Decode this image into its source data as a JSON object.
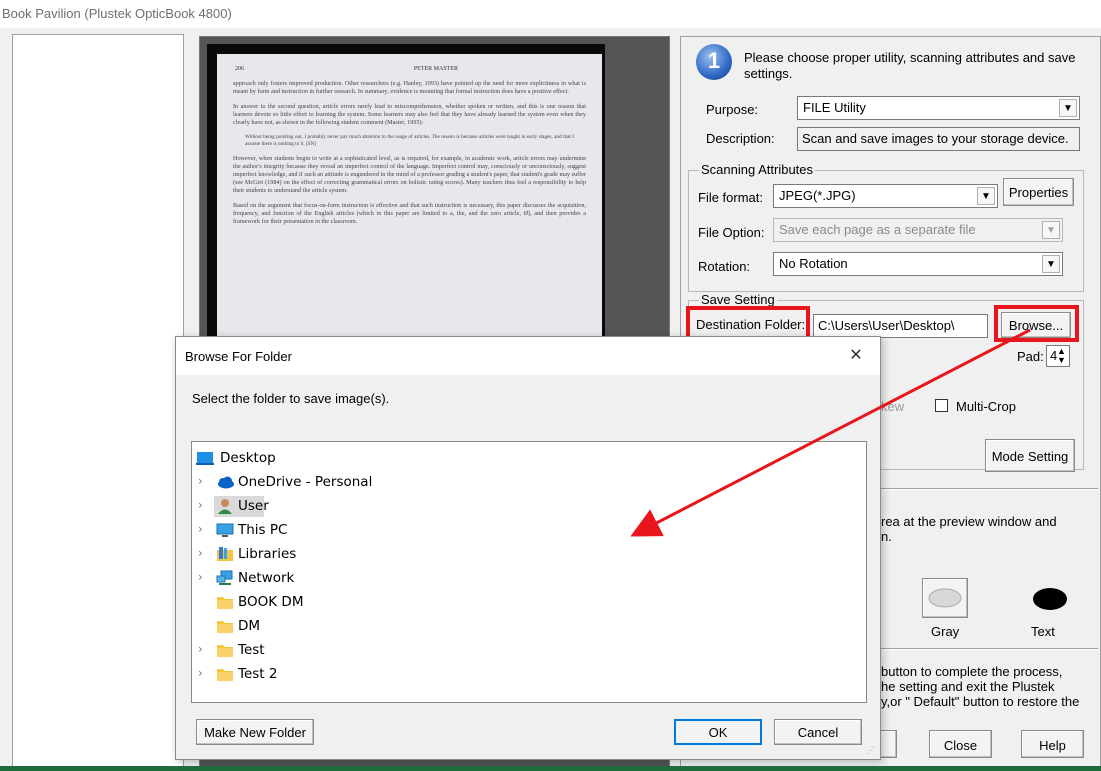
{
  "app": {
    "title": "Book Pavilion (Plustek OpticBook 4800)"
  },
  "scan_preview": {
    "page_number": "206",
    "running_head": "PETER MASTER",
    "paragraphs": [
      "approach only fosters improved production. Other researchers (e.g. Hanley, 1993) have pointed up the need for more explicitness in what is meant by form and instruction in further research. In summary, evidence is mounting that formal instruction does have a positive effect.",
      "In answer to the second question, article errors rarely lead to miscomprehension, whether spoken or written, and this is one reason that learners devote so little effort to learning the system. Some learners may also feel that they have already learned the system even when they clearly have not, as shown in the following student comment (Master, 1995):",
      "Without being pointing out, I probably never pay much attention to the usage of articles. The reason is because articles were taught in early stages, and that I assume there is nothing to it. [SN]",
      "However, when students begin to write at a sophisticated level, as is required, for example, in academic work, article errors may undermine the author's integrity because they reveal an imperfect control of the language. Imperfect control may, consciously or unconsciously, suggest imperfect knowledge, and if such an attitude is engendered in the mind of a professor grading a student's paper, that student's grade may suffer (see McGirt (1984) on the effect of correcting grammatical errors on holistic rating scores). Many teachers thus feel a responsibility to help their students to understand the article system.",
      "Based on the argument that focus-on-form instruction is effective and that such instruction is necessary, this paper discusses the acquisition, frequency, and function of the English articles (which in this paper are limited to a, the, and the zero article, Ø), and then provides a framework for their presentation in the classroom."
    ]
  },
  "settings": {
    "step_number": "1",
    "step_text": "Please choose proper utility, scanning attributes and save settings.",
    "purpose_label": "Purpose:",
    "purpose_value": "FILE Utility",
    "description_label": "Description:",
    "description_value": "Scan and save images to your storage device.",
    "scanning_group": "Scanning Attributes",
    "file_format_label": "File format:",
    "file_format_value": "JPEG(*.JPG)",
    "properties_button": "Properties",
    "file_option_label": "File Option:",
    "file_option_value": "Save each page as a separate file",
    "rotation_label": "Rotation:",
    "rotation_value": "No Rotation",
    "save_group": "Save Setting",
    "destination_label": "Destination Folder:",
    "destination_value": "C:\\Users\\User\\Desktop\\",
    "browse_button": "Browse...",
    "pad_label": "Pad:",
    "pad_value": "4",
    "deskew_partial": "kew",
    "multicrop_label": "Multi-Crop",
    "mode_setting_button": "Mode Setting",
    "step2_line1": "rea at the preview window and",
    "step2_line2": "n.",
    "gray_label": "Gray",
    "text_label": "Text",
    "step3_line1": "button to complete the process,",
    "step3_line2": "he setting and exit the Plustek",
    "step3_line3": "y,or \" Default\" button to restore the",
    "close_button": "Close",
    "help_button": "Help"
  },
  "dialog": {
    "title": "Browse For Folder",
    "prompt": "Select the folder to save image(s).",
    "tree": [
      {
        "label": "Desktop",
        "icon": "desktop-icon",
        "expander": false,
        "indent": 0,
        "selected": false
      },
      {
        "label": "OneDrive - Personal",
        "icon": "cloud-icon",
        "expander": true,
        "indent": 1,
        "selected": false
      },
      {
        "label": "User",
        "icon": "user-icon",
        "expander": true,
        "indent": 1,
        "selected": true
      },
      {
        "label": "This PC",
        "icon": "monitor-icon",
        "expander": true,
        "indent": 1,
        "selected": false
      },
      {
        "label": "Libraries",
        "icon": "libraries-icon",
        "expander": true,
        "indent": 1,
        "selected": false
      },
      {
        "label": "Network",
        "icon": "network-icon",
        "expander": true,
        "indent": 1,
        "selected": false
      },
      {
        "label": "BOOK DM",
        "icon": "folder-icon",
        "expander": false,
        "indent": 1,
        "selected": false
      },
      {
        "label": "DM",
        "icon": "folder-icon",
        "expander": false,
        "indent": 1,
        "selected": false
      },
      {
        "label": "Test",
        "icon": "folder-icon",
        "expander": true,
        "indent": 1,
        "selected": false
      },
      {
        "label": "Test 2",
        "icon": "folder-icon",
        "expander": true,
        "indent": 1,
        "selected": false
      }
    ],
    "make_new_folder_button": "Make New Folder",
    "ok_button": "OK",
    "cancel_button": "Cancel",
    "close_glyph": "✕"
  },
  "colors": {
    "annotation_red": "#e8161c",
    "folder_yellow": "#f5c542",
    "selection_gray": "#d9d9d9",
    "accent_blue": "#0078d7"
  }
}
